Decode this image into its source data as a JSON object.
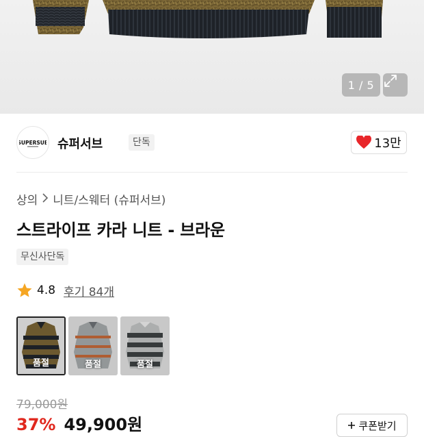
{
  "gallery": {
    "counter": "1 / 5"
  },
  "brand": {
    "logo_text": "SUPERSUB",
    "name": "슈퍼서브",
    "badge": "단독"
  },
  "like": {
    "count": "13만",
    "color": "#e8262a"
  },
  "breadcrumb": {
    "items": [
      "상의",
      "니트/스웨터 (슈퍼서브)"
    ]
  },
  "product": {
    "title": "스트라이프 카라 니트 - 브라운",
    "tag": "무신사단독"
  },
  "rating": {
    "score": "4.8",
    "reviews": "후기 84개",
    "star_color": "#f5a623"
  },
  "options": [
    {
      "label": "품절",
      "variant": "brown-navy stripe",
      "selected": true
    },
    {
      "label": "품절",
      "variant": "grey-orange stripe",
      "selected": false
    },
    {
      "label": "품절",
      "variant": "grey-charcoal stripe",
      "selected": false
    }
  ],
  "pricing": {
    "original": "79,000원",
    "discount": "37%",
    "price": "49,900원",
    "discount_color": "#e0281e",
    "coupon_label": "쿠폰받기"
  }
}
